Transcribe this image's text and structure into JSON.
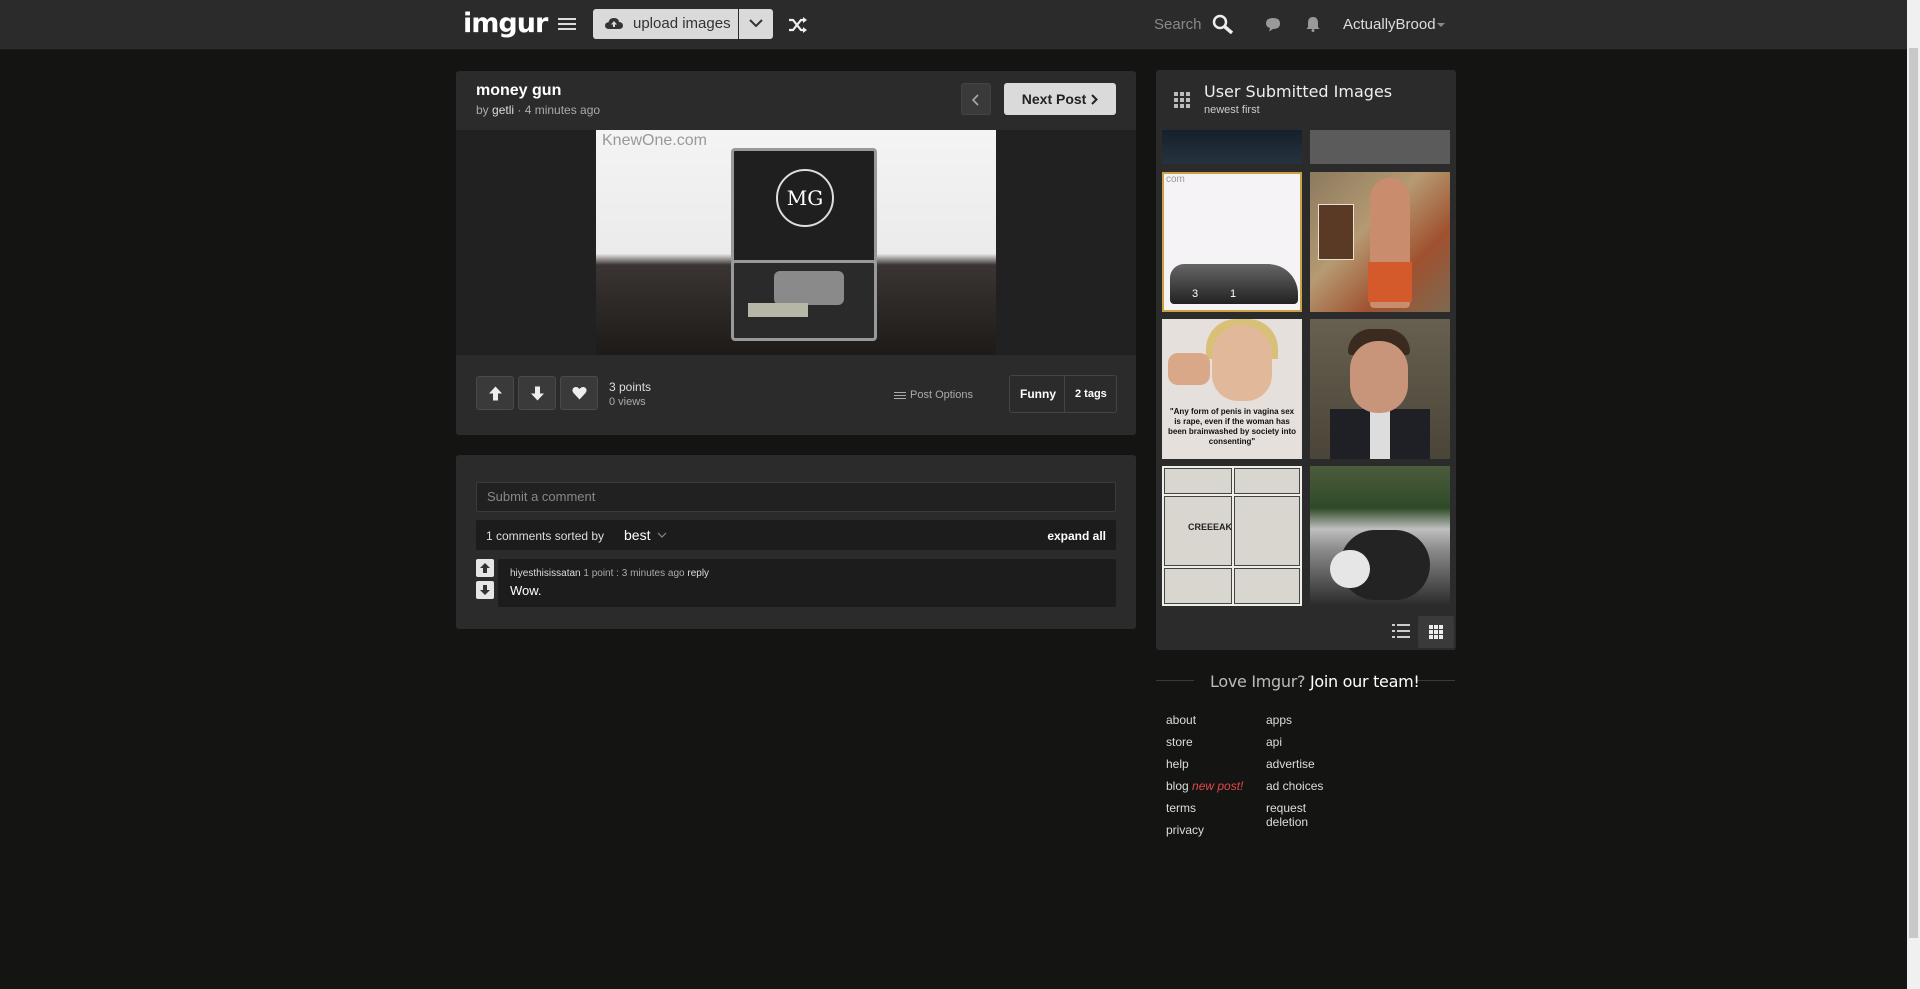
{
  "header": {
    "logo": "imgur",
    "upload_label": "upload images",
    "search_placeholder": "Search",
    "username": "ActuallyBrood"
  },
  "post": {
    "title": "money gun",
    "by_prefix": "by ",
    "author": "getli",
    "time": " · 4 minutes ago",
    "next_label": "Next Post",
    "image_watermark": "KnewOne.com",
    "image_logo": "MG",
    "points": "3 points",
    "views": "0 views",
    "post_options_label": "Post Options",
    "tag_name": "Funny",
    "tag_count": "2 tags"
  },
  "comments": {
    "input_placeholder": "Submit a comment",
    "sort_text": "1 comments sorted by",
    "sort_value": "best",
    "expand_all": "expand all",
    "items": [
      {
        "user": "hiyesthisissatan",
        "points": "1 point",
        "separator": " : ",
        "time": "3 minutes ago",
        "reply": "reply",
        "text": "Wow."
      }
    ]
  },
  "sidebar": {
    "title": "User Submitted Images",
    "subtitle": "newest first",
    "thumb1": {
      "watermark": "com",
      "count_a": "3",
      "count_b": "1"
    },
    "thumb3_quote": "\"Any form of penis in vagina sex is rape, even if the woman has been brainwashed by society into consenting\"",
    "thumb5_text": "CREEEAK"
  },
  "footer": {
    "love": "Love Imgur?",
    "join": "Join our team!",
    "links_left": [
      "about",
      "store",
      "help",
      "blog",
      "terms",
      "privacy"
    ],
    "blog_new": "new post!",
    "links_right": [
      "apps",
      "api",
      "advertise",
      "ad choices",
      "request",
      "deletion"
    ]
  },
  "colors": {
    "background": "#141413",
    "panel": "#2b2b2b",
    "topbar": "#2b2b2b",
    "selected_thumb_border": "#c9a246",
    "new_post": "#e04a4a"
  },
  "icons": [
    "hamburger-icon",
    "cloud-upload-icon",
    "chevron-down-icon",
    "shuffle-icon",
    "search-icon",
    "chat-icon",
    "bell-icon",
    "chevron-left-icon",
    "chevron-right-icon",
    "upvote-icon",
    "downvote-icon",
    "heart-icon",
    "grid-icon",
    "list-view-icon"
  ]
}
